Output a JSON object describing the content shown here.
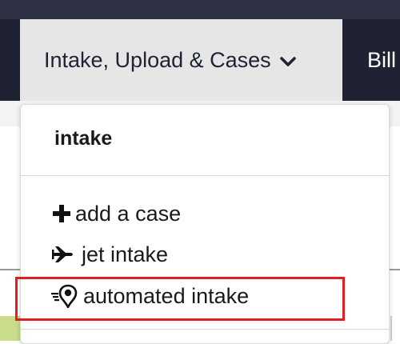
{
  "nav": {
    "active_tab": {
      "label": "Intake, Upload & Cases",
      "icon": "chevron-down-icon"
    },
    "next_tab": {
      "label": "Bill"
    }
  },
  "dropdown": {
    "header": "intake",
    "items": [
      {
        "label": "add a case",
        "icon": "plus-icon"
      },
      {
        "label": "jet intake",
        "icon": "jet-icon"
      },
      {
        "label": "automated intake",
        "icon": "automated-intake-icon"
      }
    ]
  },
  "colors": {
    "navbar": "#1f2233",
    "active_tab": "#e6e6e6",
    "highlight": "#e02020"
  }
}
